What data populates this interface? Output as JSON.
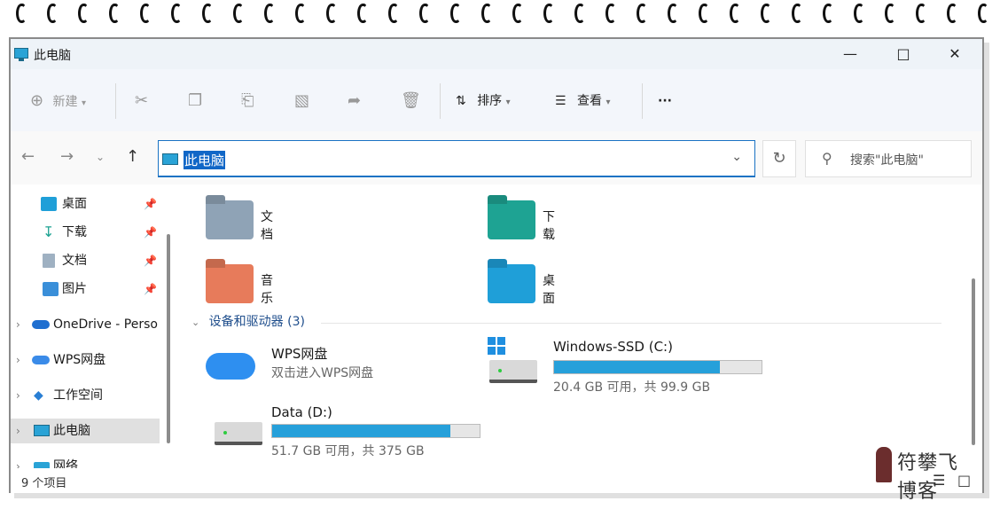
{
  "window": {
    "title": "此电脑"
  },
  "toolbar": {
    "new_label": "新建",
    "sort_label": "排序",
    "view_label": "查看",
    "more_label": "···"
  },
  "address": {
    "path": "此电脑"
  },
  "search": {
    "placeholder": "搜索\"此电脑\""
  },
  "sidebar": {
    "items": [
      {
        "label": "桌面"
      },
      {
        "label": "下载"
      },
      {
        "label": "文档"
      },
      {
        "label": "图片"
      },
      {
        "label": "OneDrive - Perso"
      },
      {
        "label": "WPS网盘"
      },
      {
        "label": "工作空间"
      },
      {
        "label": "此电脑"
      },
      {
        "label": "网络"
      }
    ]
  },
  "folders": [
    {
      "label": "文档",
      "color": "#8fa3b6"
    },
    {
      "label": "下载",
      "color": "#1ea393"
    },
    {
      "label": "音乐",
      "color": "#e77b5b"
    },
    {
      "label": "桌面",
      "color": "#1f9fd8"
    }
  ],
  "devices_group": {
    "label": "设备和驱动器 (3)"
  },
  "devices": {
    "wps": {
      "name": "WPS网盘",
      "sub": "双击进入WPS网盘"
    },
    "c_drive": {
      "name": "Windows-SSD (C:)",
      "sub": "20.4 GB 可用，共 99.9 GB",
      "used_fraction": 0.8
    },
    "d_drive": {
      "name": "Data (D:)",
      "sub": "51.7 GB 可用，共 375 GB",
      "used_fraction": 0.86
    }
  },
  "status": {
    "item_count": "9 个项目"
  },
  "watermark": {
    "text": "符攀飞博客"
  }
}
